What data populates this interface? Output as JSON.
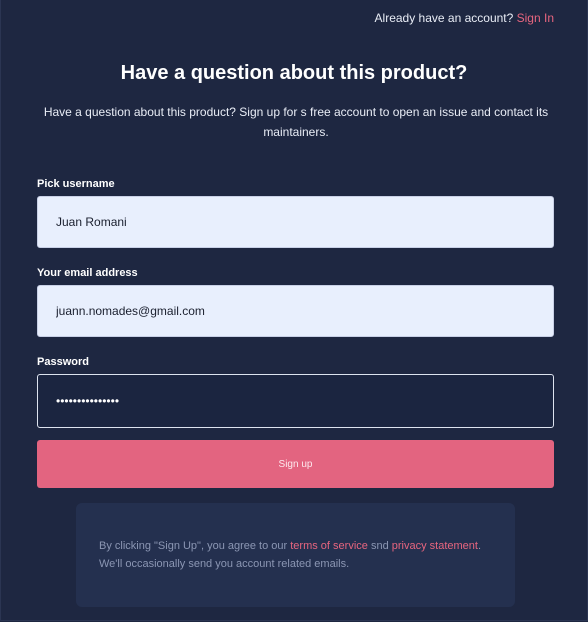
{
  "header": {
    "account_prompt": "Already have an account?",
    "signin_label": "Sign In"
  },
  "main": {
    "title": "Have a question about this product?",
    "subtitle": "Have a question about this product? Sign up for s free account to open an issue and contact its maintainers."
  },
  "form": {
    "username": {
      "label": "Pick username",
      "value": "Juan Romani"
    },
    "email": {
      "label": "Your email address",
      "value": "juann.nomades@gmail.com"
    },
    "password": {
      "label": "Password",
      "value": "password1234567"
    },
    "submit_label": "Sign up"
  },
  "terms": {
    "prefix": "By clicking \"Sign Up\", you agree to our",
    "terms_link": "terms of service",
    "conjunction": "snd",
    "privacy_link": "privacy statement",
    "period": ".",
    "note": "We'll occasionally send you account related emails."
  },
  "colors": {
    "background": "#1e2741",
    "accent": "#e36480",
    "link": "#e7657f",
    "input_fill": "#e8effd",
    "terms_box": "#24304f"
  }
}
